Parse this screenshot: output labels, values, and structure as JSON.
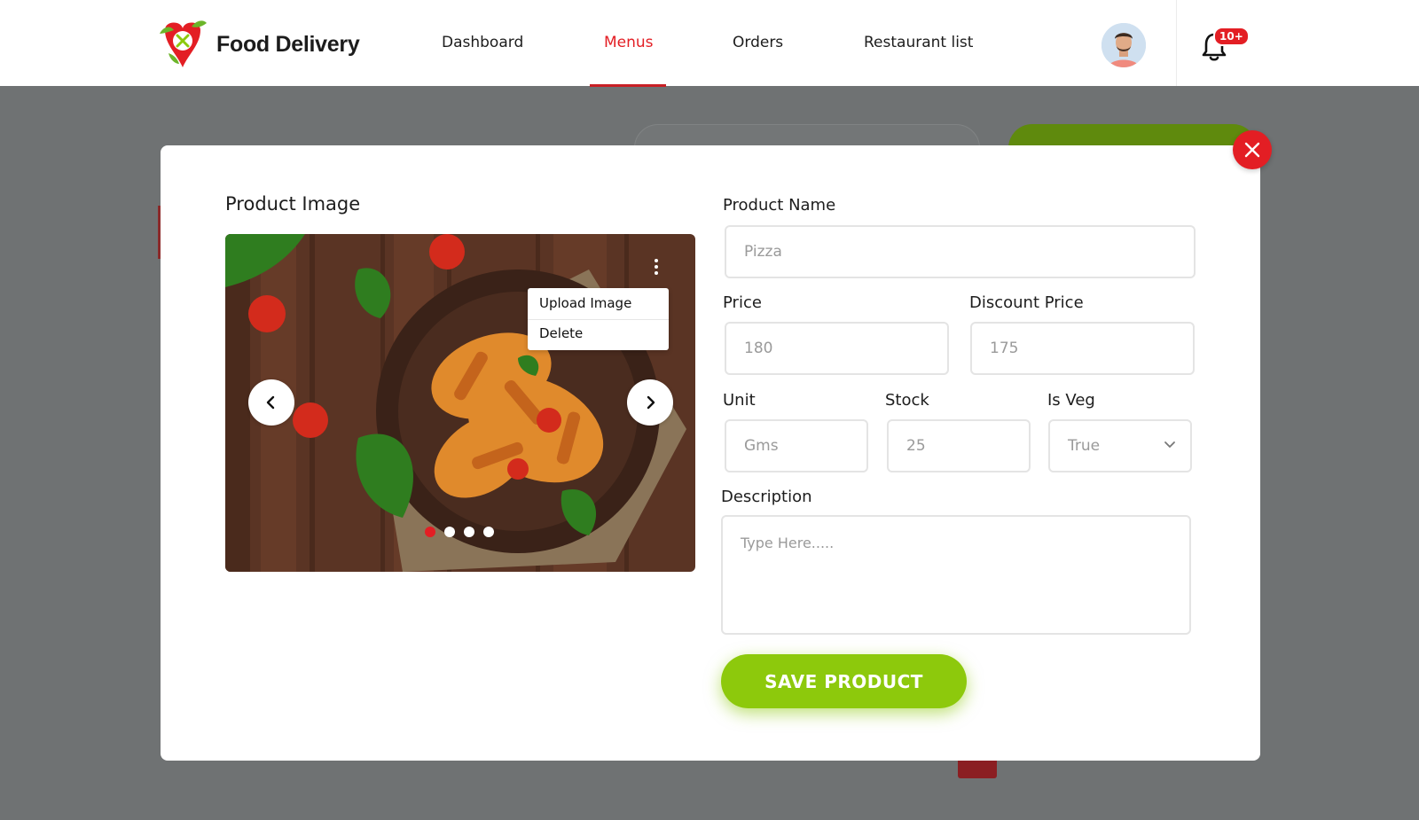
{
  "header": {
    "brand": "Food Delivery",
    "nav": [
      {
        "label": "Dashboard",
        "active": false
      },
      {
        "label": "Menus",
        "active": true
      },
      {
        "label": "Orders",
        "active": false
      },
      {
        "label": "Restaurant list",
        "active": false
      }
    ],
    "notification_badge": "10+"
  },
  "modal": {
    "product_image_label": "Product Image",
    "image_menu": {
      "upload": "Upload Image",
      "delete": "Delete"
    },
    "carousel": {
      "slide_count": 4,
      "active_index": 0
    },
    "product_name": {
      "label": "Product Name",
      "placeholder": "Pizza"
    },
    "price": {
      "label": "Price",
      "placeholder": "180"
    },
    "discount_price": {
      "label": "Discount Price",
      "placeholder": "175"
    },
    "unit": {
      "label": "Unit",
      "placeholder": "Gms"
    },
    "stock": {
      "label": "Stock",
      "placeholder": "25"
    },
    "is_veg": {
      "label": "Is Veg",
      "value": "True"
    },
    "description": {
      "label": "Description",
      "placeholder": "Type Here....."
    },
    "save_label": "SAVE PRODUCT"
  },
  "colors": {
    "accent_red": "#e31e24",
    "accent_green": "#8dc90c",
    "overlay": "#6f7273"
  }
}
